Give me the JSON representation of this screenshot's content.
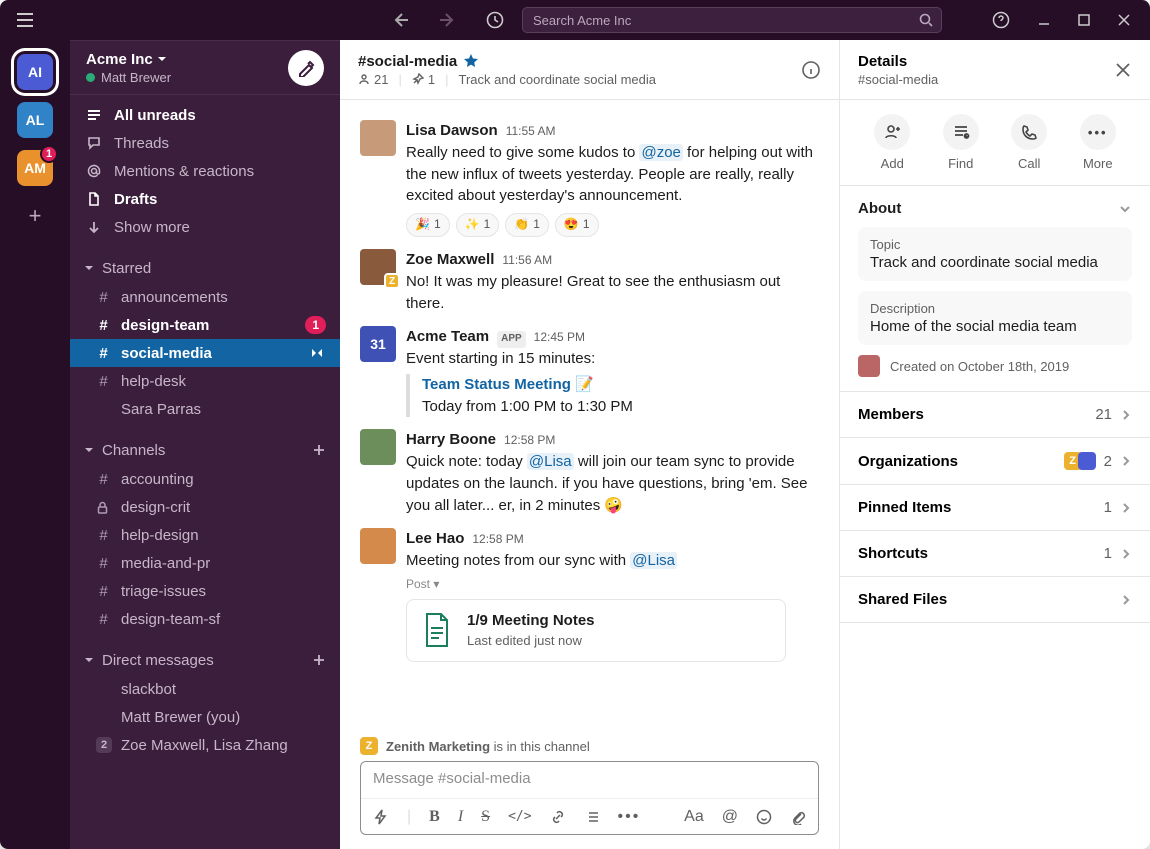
{
  "titlebar": {
    "search_placeholder": "Search Acme Inc"
  },
  "workspaces": [
    {
      "initials": "AI",
      "color": "#4a5bd4",
      "selected": true,
      "notif": null
    },
    {
      "initials": "AL",
      "color": "#3183c8",
      "selected": false,
      "notif": null
    },
    {
      "initials": "AM",
      "color": "#e8912d",
      "selected": false,
      "notif": "1"
    }
  ],
  "sidebar": {
    "workspace_name": "Acme Inc",
    "user_name": "Matt Brewer",
    "nav": {
      "all_unreads": "All unreads",
      "threads": "Threads",
      "mentions": "Mentions & reactions",
      "drafts": "Drafts",
      "show_more": "Show more"
    },
    "sections": {
      "starred": "Starred",
      "channels": "Channels",
      "dms": "Direct messages"
    },
    "starred": [
      {
        "prefix": "#",
        "name": "announcements",
        "bold": false
      },
      {
        "prefix": "#",
        "name": "design-team",
        "bold": true,
        "badge": "1"
      },
      {
        "prefix": "#",
        "name": "social-media",
        "bold": true,
        "active": true
      },
      {
        "prefix": "#",
        "name": "help-desk",
        "bold": false
      },
      {
        "prefix": "●",
        "name": "Sara Parras",
        "bold": false
      }
    ],
    "channels": [
      {
        "prefix": "#",
        "name": "accounting"
      },
      {
        "prefix": "🔒",
        "name": "design-crit"
      },
      {
        "prefix": "#",
        "name": "help-design"
      },
      {
        "prefix": "#",
        "name": "media-and-pr"
      },
      {
        "prefix": "#",
        "name": "triage-issues"
      },
      {
        "prefix": "#",
        "name": "design-team-sf"
      }
    ],
    "dms": [
      {
        "presence": true,
        "name": "slackbot"
      },
      {
        "presence": true,
        "name": "Matt Brewer (you)"
      },
      {
        "count": "2",
        "name": "Zoe Maxwell, Lisa Zhang"
      }
    ]
  },
  "channel": {
    "name": "#social-media",
    "starred": true,
    "member_count": "21",
    "pin_count": "1",
    "topic": "Track and coordinate social media",
    "messages": [
      {
        "author": "Lisa Dawson",
        "time": "11:55 AM",
        "avatar": "#c79b7a",
        "text_parts": [
          "Really need to give some kudos to ",
          "@zoe",
          " for helping out with the new influx of tweets yesterday. People are really, really excited about yesterday's announcement."
        ],
        "reactions": [
          {
            "e": "🎉",
            "n": "1"
          },
          {
            "e": "✨",
            "n": "1"
          },
          {
            "e": "👏",
            "n": "1"
          },
          {
            "e": "😍",
            "n": "1"
          }
        ]
      },
      {
        "author": "Zoe Maxwell",
        "time": "11:56 AM",
        "avatar": "#8a5a3c",
        "ext_badge": "Z",
        "text": "No! It was my pleasure! Great to see the enthusiasm out there."
      },
      {
        "author": "Acme Team",
        "app": "APP",
        "time": "12:45 PM",
        "avatar": "cal",
        "cal": "31",
        "text": "Event starting in 15 minutes:",
        "event": {
          "title": "Team Status Meeting",
          "emoji": "📝",
          "when": "Today from 1:00 PM to 1:30 PM"
        }
      },
      {
        "author": "Harry Boone",
        "time": "12:58 PM",
        "avatar": "#6b8e5a",
        "text_parts": [
          "Quick note: today ",
          "@Lisa",
          " will join our team sync to provide updates on the launch. if you have questions, bring 'em. See you all later... er, in 2 minutes 🤪"
        ]
      },
      {
        "author": "Lee Hao",
        "time": "12:58 PM",
        "avatar": "#d48a4a",
        "text_parts": [
          "Meeting notes from our sync with ",
          "@Lisa"
        ],
        "post_label": "Post ▾",
        "attachment": {
          "title": "1/9 Meeting Notes",
          "sub": "Last edited just now"
        }
      }
    ],
    "org_notice": {
      "chip": "Z",
      "name": "Zenith Marketing",
      "text": "is in this channel"
    },
    "composer_placeholder": "Message #social-media"
  },
  "details": {
    "title": "Details",
    "subtitle": "#social-media",
    "actions": {
      "add": "Add",
      "find": "Find",
      "call": "Call",
      "more": "More"
    },
    "about": {
      "heading": "About",
      "topic_label": "Topic",
      "topic": "Track and coordinate social media",
      "desc_label": "Description",
      "desc": "Home of the social media team",
      "created": "Created on October 18th, 2019"
    },
    "rows": {
      "members": {
        "label": "Members",
        "count": "21"
      },
      "orgs": {
        "label": "Organizations",
        "count": "2"
      },
      "pinned": {
        "label": "Pinned Items",
        "count": "1"
      },
      "shortcuts": {
        "label": "Shortcuts",
        "count": "1"
      },
      "files": {
        "label": "Shared Files"
      }
    }
  }
}
